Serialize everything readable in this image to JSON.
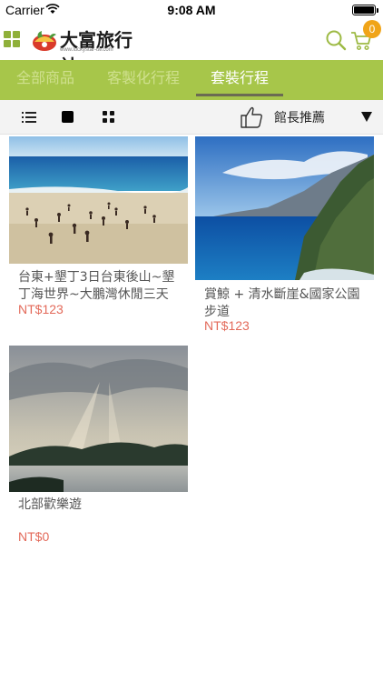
{
  "status_bar": {
    "carrier": "Carrier",
    "time": "9:08 AM",
    "icons": [
      "wifi-icon",
      "battery-icon"
    ]
  },
  "header": {
    "logo_text": "大富旅行社",
    "logo_subtext": "www.luckystar-tw.com",
    "menu_icon": "grid-menu-icon",
    "search_icon": "search-icon",
    "cart_icon": "cart-icon",
    "cart_count": "0"
  },
  "tabs": [
    {
      "label": "全部商品",
      "active": false
    },
    {
      "label": "客製化行程",
      "active": false
    },
    {
      "label": "套裝行程",
      "active": true
    }
  ],
  "toolbar": {
    "view_icons": [
      "list-view-icon",
      "single-view-icon",
      "grid-view-icon"
    ],
    "sort_icon": "thumbs-up-icon",
    "sort_label": "館長推薦",
    "dropdown_icon": "triangle-down-icon"
  },
  "products": [
    {
      "title": "台東+墾丁3日台東後山~墾丁海世界~大鵬灣休閒三天",
      "price": "NT$123",
      "image": "beach-crowd-photo"
    },
    {
      "title": "賞鯨 + 清水斷崖&國家公園步道",
      "price": "NT$123",
      "image": "coastal-cliff-photo"
    },
    {
      "title": "北部歡樂遊",
      "price": "NT$0",
      "image": "lake-sunrays-photo"
    }
  ],
  "colors": {
    "accent_green": "#a7c64a",
    "icon_green": "#8fb03a",
    "price_red": "#e36a5a",
    "badge_orange": "#f0a418"
  }
}
